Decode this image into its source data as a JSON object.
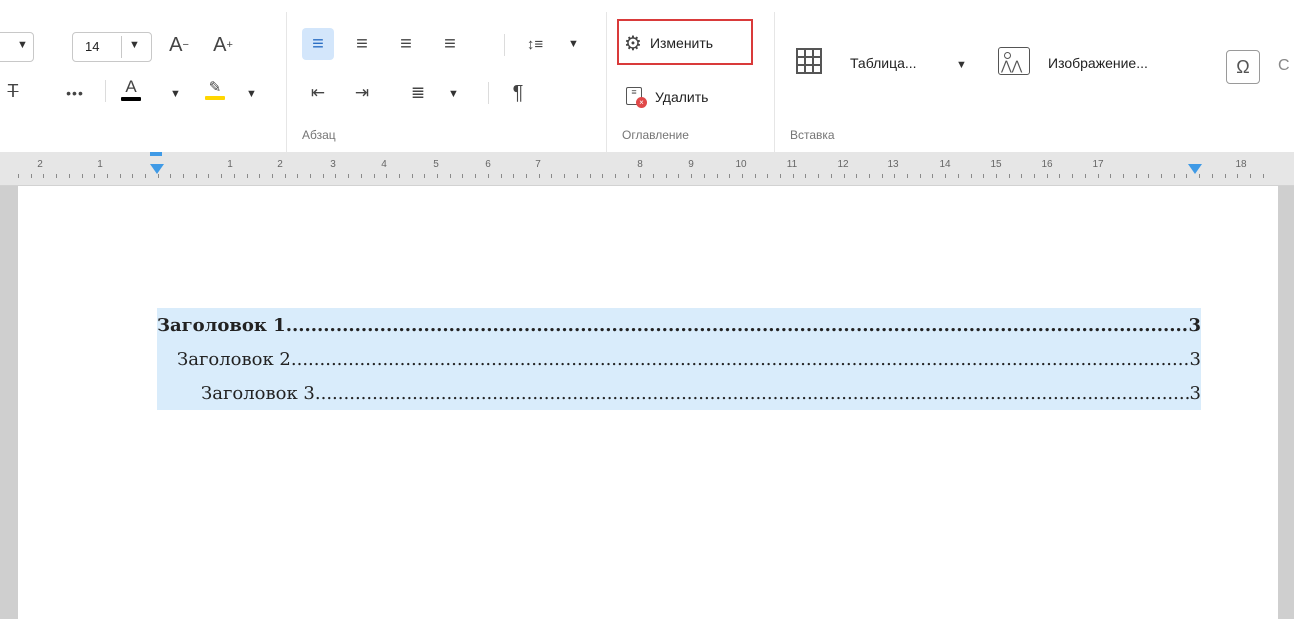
{
  "font": {
    "size": "14"
  },
  "paragraph": {
    "group_label": "Абзац"
  },
  "toc": {
    "group_label": "Оглавление",
    "edit_label": "Изменить",
    "delete_label": "Удалить"
  },
  "insert": {
    "group_label": "Вставка",
    "table_label": "Таблица...",
    "image_label": "Изображение..."
  },
  "colors": {
    "highlight_outline": "#d93a3a",
    "font_color": "#000000",
    "highlight_color": "#ffd600",
    "toc_selection": "#d9ecfb",
    "ruler_marker": "#3f9ae6"
  },
  "ruler": {
    "numbers": [
      "2",
      "1",
      "1",
      "2",
      "3",
      "4",
      "5",
      "6",
      "7",
      "8",
      "9",
      "10",
      "11",
      "12",
      "13",
      "14",
      "15",
      "16",
      "17",
      "18"
    ]
  },
  "document": {
    "toc_entries": [
      {
        "text": "Заголовок 1",
        "page": "3",
        "level": 1
      },
      {
        "text": "Заголовок 2",
        "page": "3",
        "level": 2
      },
      {
        "text": "Заголовок 3",
        "page": "3",
        "level": 3
      }
    ]
  }
}
